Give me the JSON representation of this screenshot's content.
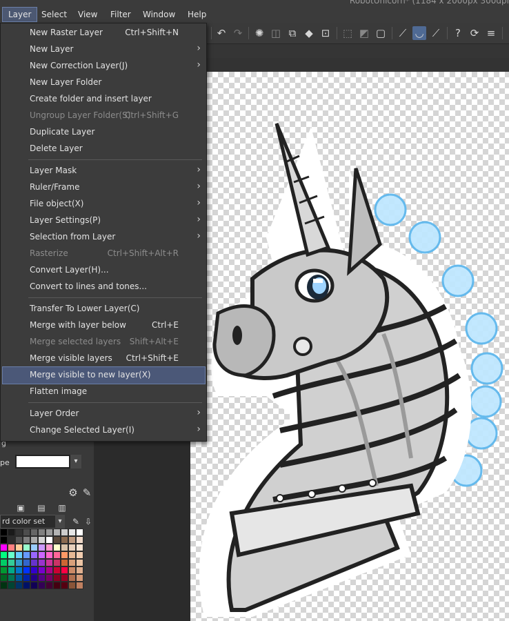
{
  "window": {
    "title": "RobotUnicorn* (1184 x 2000px 300dpi"
  },
  "menubar": [
    {
      "label": "Layer",
      "active": true
    },
    {
      "label": "Select"
    },
    {
      "label": "View"
    },
    {
      "label": "Filter"
    },
    {
      "label": "Window"
    },
    {
      "label": "Help"
    }
  ],
  "layer_menu": [
    {
      "label": "New Raster Layer",
      "shortcut": "Ctrl+Shift+N"
    },
    {
      "label": "New Layer",
      "submenu": true
    },
    {
      "label": "New Correction Layer(J)",
      "submenu": true
    },
    {
      "label": "New Layer Folder"
    },
    {
      "label": "Create folder and insert layer"
    },
    {
      "label": "Ungroup Layer Folder(S)",
      "shortcut": "Ctrl+Shift+G",
      "disabled": true
    },
    {
      "label": "Duplicate Layer"
    },
    {
      "label": "Delete Layer"
    },
    {
      "separator": true
    },
    {
      "label": "Layer Mask",
      "submenu": true
    },
    {
      "label": "Ruler/Frame",
      "submenu": true
    },
    {
      "label": "File object(X)",
      "submenu": true
    },
    {
      "label": "Layer Settings(P)",
      "submenu": true
    },
    {
      "label": "Selection from Layer",
      "submenu": true
    },
    {
      "label": "Rasterize",
      "shortcut": "Ctrl+Shift+Alt+R",
      "disabled": true
    },
    {
      "label": "Convert Layer(H)..."
    },
    {
      "label": "Convert to lines and tones..."
    },
    {
      "separator": true
    },
    {
      "label": "Transfer To Lower Layer(C)"
    },
    {
      "label": "Merge with layer below",
      "shortcut": "Ctrl+E"
    },
    {
      "label": "Merge selected layers",
      "shortcut": "Shift+Alt+E",
      "disabled": true
    },
    {
      "label": "Merge visible layers",
      "shortcut": "Ctrl+Shift+E"
    },
    {
      "label": "Merge visible to new layer(X)",
      "highlighted": true
    },
    {
      "label": "Flatten image"
    },
    {
      "separator": true
    },
    {
      "label": "Layer Order",
      "submenu": true
    },
    {
      "label": "Change Selected Layer(I)",
      "submenu": true
    }
  ],
  "left_panel": {
    "label_g": "g",
    "label_type": "pe",
    "color_set": "rd color set"
  },
  "palette_colors": [
    "#000000",
    "#1a1a1a",
    "#333333",
    "#4d4d4d",
    "#666666",
    "#808080",
    "#999999",
    "#b3b3b3",
    "#cccccc",
    "#e6e6e6",
    "#ffffff",
    "#000000",
    "#2b2b2b",
    "#555555",
    "#7f7f7f",
    "#aaaaaa",
    "#d4d4d4",
    "#ffffff",
    "#5a4a3c",
    "#8a6a50",
    "#bf9a80",
    "#f0d8c8",
    "#ff00ff",
    "#ff8080",
    "#ffcc99",
    "#99ffcc",
    "#99ccff",
    "#cc99ff",
    "#ff99cc",
    "#ffffcc",
    "#d9c2a8",
    "#e8d0bc",
    "#f8e4d4",
    "#00ff80",
    "#66ffcc",
    "#66ccff",
    "#6699ff",
    "#9966ff",
    "#cc66ff",
    "#ff66cc",
    "#ff6699",
    "#ff9966",
    "#e6b894",
    "#f2cdb0",
    "#00cc66",
    "#33cc99",
    "#3399cc",
    "#3366cc",
    "#6633cc",
    "#9933cc",
    "#cc3399",
    "#cc3366",
    "#cc6633",
    "#d9a07a",
    "#ecc4a4",
    "#009933",
    "#00aa88",
    "#0077cc",
    "#0033ff",
    "#3300cc",
    "#7700cc",
    "#aa0088",
    "#cc0033",
    "#ff0044",
    "#cc8a66",
    "#e0b090",
    "#006622",
    "#007755",
    "#005599",
    "#0022aa",
    "#220088",
    "#550088",
    "#770066",
    "#880022",
    "#990022",
    "#b07050",
    "#d49a78",
    "#003311",
    "#004433",
    "#003366",
    "#001166",
    "#110055",
    "#330055",
    "#440033",
    "#440011",
    "#550011",
    "#8a5538",
    "#c08060"
  ]
}
